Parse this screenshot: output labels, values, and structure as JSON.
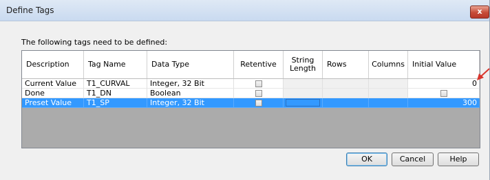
{
  "window": {
    "title": "Define Tags",
    "close_label": "x"
  },
  "instruction": "The following tags need to be defined:",
  "columns": [
    "Description",
    "Tag Name",
    "Data Type",
    "Retentive",
    "String Length",
    "Rows",
    "Columns",
    "Initial Value"
  ],
  "rows": [
    {
      "description": "Current Value",
      "tag_name": "T1_CURVAL",
      "data_type": "Integer, 32 Bit",
      "retentive": false,
      "initial_value": "0"
    },
    {
      "description": "Done",
      "tag_name": "T1_DN",
      "data_type": "Boolean",
      "retentive": false,
      "initial_value": ""
    },
    {
      "description": "Preset Value",
      "tag_name": "T1_SP",
      "data_type": "Integer, 32 Bit",
      "retentive": false,
      "initial_value": "300"
    }
  ],
  "buttons": {
    "ok": "OK",
    "cancel": "Cancel",
    "help": "Help"
  },
  "colors": {
    "selection": "#3399ff",
    "annotation_arrow": "#d9342b"
  }
}
